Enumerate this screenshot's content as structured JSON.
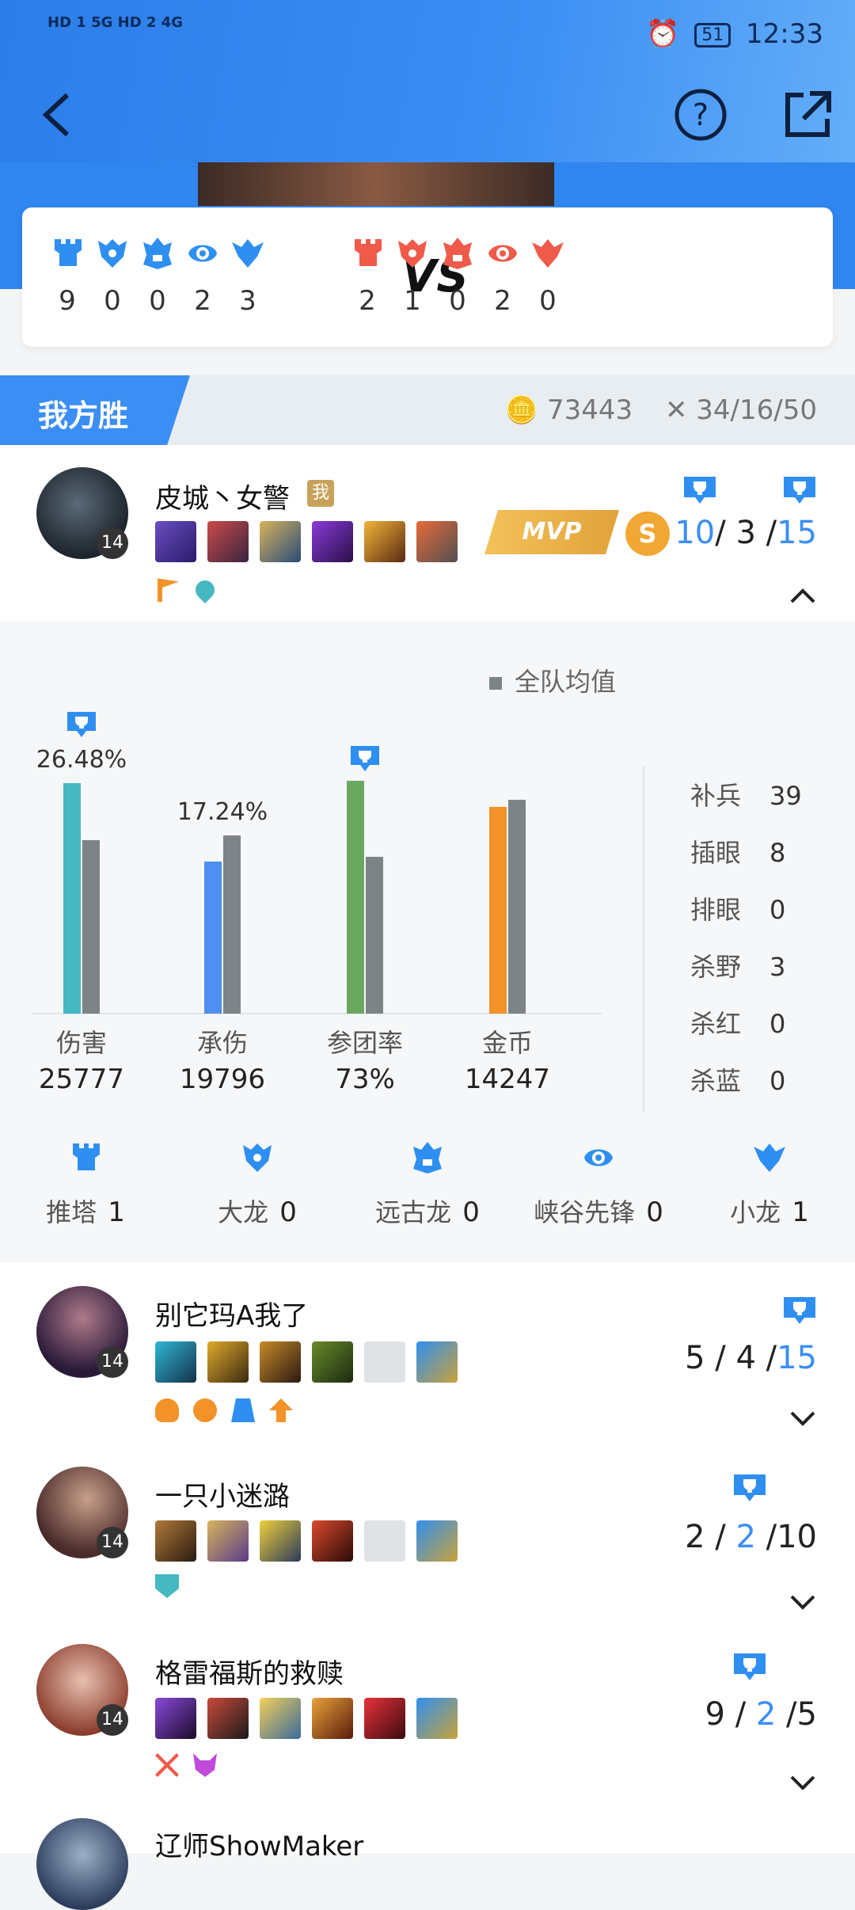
{
  "status_bar": {
    "left": "HD 1 5G  HD 2 4G",
    "battery": "51",
    "time": "12:33"
  },
  "score": {
    "ally": [
      9,
      0,
      0,
      2,
      3
    ],
    "enemy": [
      2,
      1,
      0,
      2,
      0
    ],
    "vs_label": "VS",
    "ally_color": "#2f8ff0",
    "enemy_color": "#ef5a4a"
  },
  "result": {
    "label": "我方胜",
    "gold": "73443",
    "kda": "34/16/50"
  },
  "players": [
    {
      "name": "皮城丶女警",
      "me_badge": "我",
      "level": "14",
      "mvp": "MVP",
      "s_badge": "S",
      "kda": {
        "k": "10",
        "d": "3",
        "a": "15"
      }
    },
    {
      "name": "别它玛A我了",
      "level": "14",
      "kda": {
        "k": "5",
        "d": "4",
        "a": "15"
      }
    },
    {
      "name": "一只小迷潞",
      "level": "14",
      "kda": {
        "k": "2",
        "d": "2",
        "a": "10"
      }
    },
    {
      "name": "格雷福斯的救赎",
      "level": "14",
      "kda": {
        "k": "9",
        "d": "2",
        "a": "5"
      }
    },
    {
      "name": "辽师ShowMaker"
    }
  ],
  "chart_data": {
    "type": "bar",
    "legend": "全队均值",
    "categories": [
      "伤害",
      "承伤",
      "参团率",
      "金币"
    ],
    "value_labels": [
      "25777",
      "19796",
      "73%",
      "14247"
    ],
    "top_labels": [
      "26.48%",
      "17.24%",
      "",
      ""
    ],
    "series": [
      {
        "values": [
          0.97,
          0.64,
          0.98,
          0.87
        ],
        "colors": [
          "#45b8c2",
          "#4e8ff0",
          "#6aa862",
          "#f29228"
        ]
      },
      {
        "name": "全队均值",
        "values": [
          0.73,
          0.75,
          0.66,
          0.9
        ],
        "color": "#7c8487"
      }
    ],
    "trophy_on": [
      0,
      2
    ]
  },
  "side_stats": [
    {
      "label": "补兵",
      "value": "39"
    },
    {
      "label": "插眼",
      "value": "8"
    },
    {
      "label": "排眼",
      "value": "0"
    },
    {
      "label": "杀野",
      "value": "3"
    },
    {
      "label": "杀红",
      "value": "0"
    },
    {
      "label": "杀蓝",
      "value": "0"
    }
  ],
  "objectives": [
    {
      "label": "推塔",
      "value": "1",
      "icon": "tower-icon"
    },
    {
      "label": "大龙",
      "value": "0",
      "icon": "baron-icon"
    },
    {
      "label": "远古龙",
      "value": "0",
      "icon": "elder-dragon-icon"
    },
    {
      "label": "峡谷先锋",
      "value": "0",
      "icon": "herald-icon"
    },
    {
      "label": "小龙",
      "value": "1",
      "icon": "dragon-icon"
    }
  ]
}
